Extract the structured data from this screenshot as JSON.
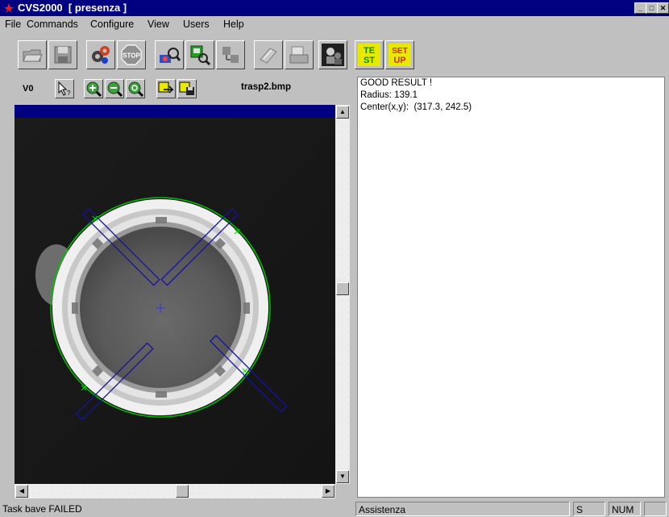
{
  "window": {
    "title": "CVS2000  [ presenza ]",
    "controls": [
      "_",
      "□",
      "✕"
    ]
  },
  "menu": [
    {
      "label": "File"
    },
    {
      "label": "Commands"
    },
    {
      "label": "Configure"
    },
    {
      "label": "View"
    },
    {
      "label": "Users"
    },
    {
      "label": "Help"
    }
  ],
  "toolbar": {
    "buttons": [
      {
        "icon": "open-folder-icon"
      },
      {
        "icon": "save-disk-icon"
      },
      {
        "icon": "run-gears-icon"
      },
      {
        "icon": "stop-icon",
        "text": "STOP"
      },
      {
        "icon": "inspect-zoom-icon"
      },
      {
        "icon": "camera-zoom-icon"
      },
      {
        "icon": "network-icon"
      },
      {
        "icon": "edit-sheet-icon"
      },
      {
        "icon": "print-icon"
      },
      {
        "icon": "users-icon"
      },
      {
        "icon": "test-icon",
        "text": "TE ST"
      },
      {
        "icon": "setup-icon",
        "text": "SET UP"
      }
    ],
    "test_label_top": "TE",
    "test_label_bottom": "ST",
    "setup_label_top": "SET",
    "setup_label_bottom": "UP"
  },
  "view": {
    "label": "V0",
    "filename": "trasp2.bmp",
    "tools": [
      "select-pointer-icon",
      "zoom-in-icon",
      "zoom-out-icon",
      "zoom-fit-icon",
      "load-image-icon",
      "save-image-icon"
    ]
  },
  "results": {
    "line1": "GOOD RESULT !",
    "line2": "Radius: 139.1",
    "line3": "Center(x,y):  (317.3, 242.5)"
  },
  "status": {
    "left": "Task bave FAILED",
    "panel": "Assistenza",
    "s": "S",
    "num": "NUM"
  },
  "colors": {
    "title_bar": "#000080",
    "circle_fit": "#00c000",
    "roi_lines": "#1010a0"
  }
}
